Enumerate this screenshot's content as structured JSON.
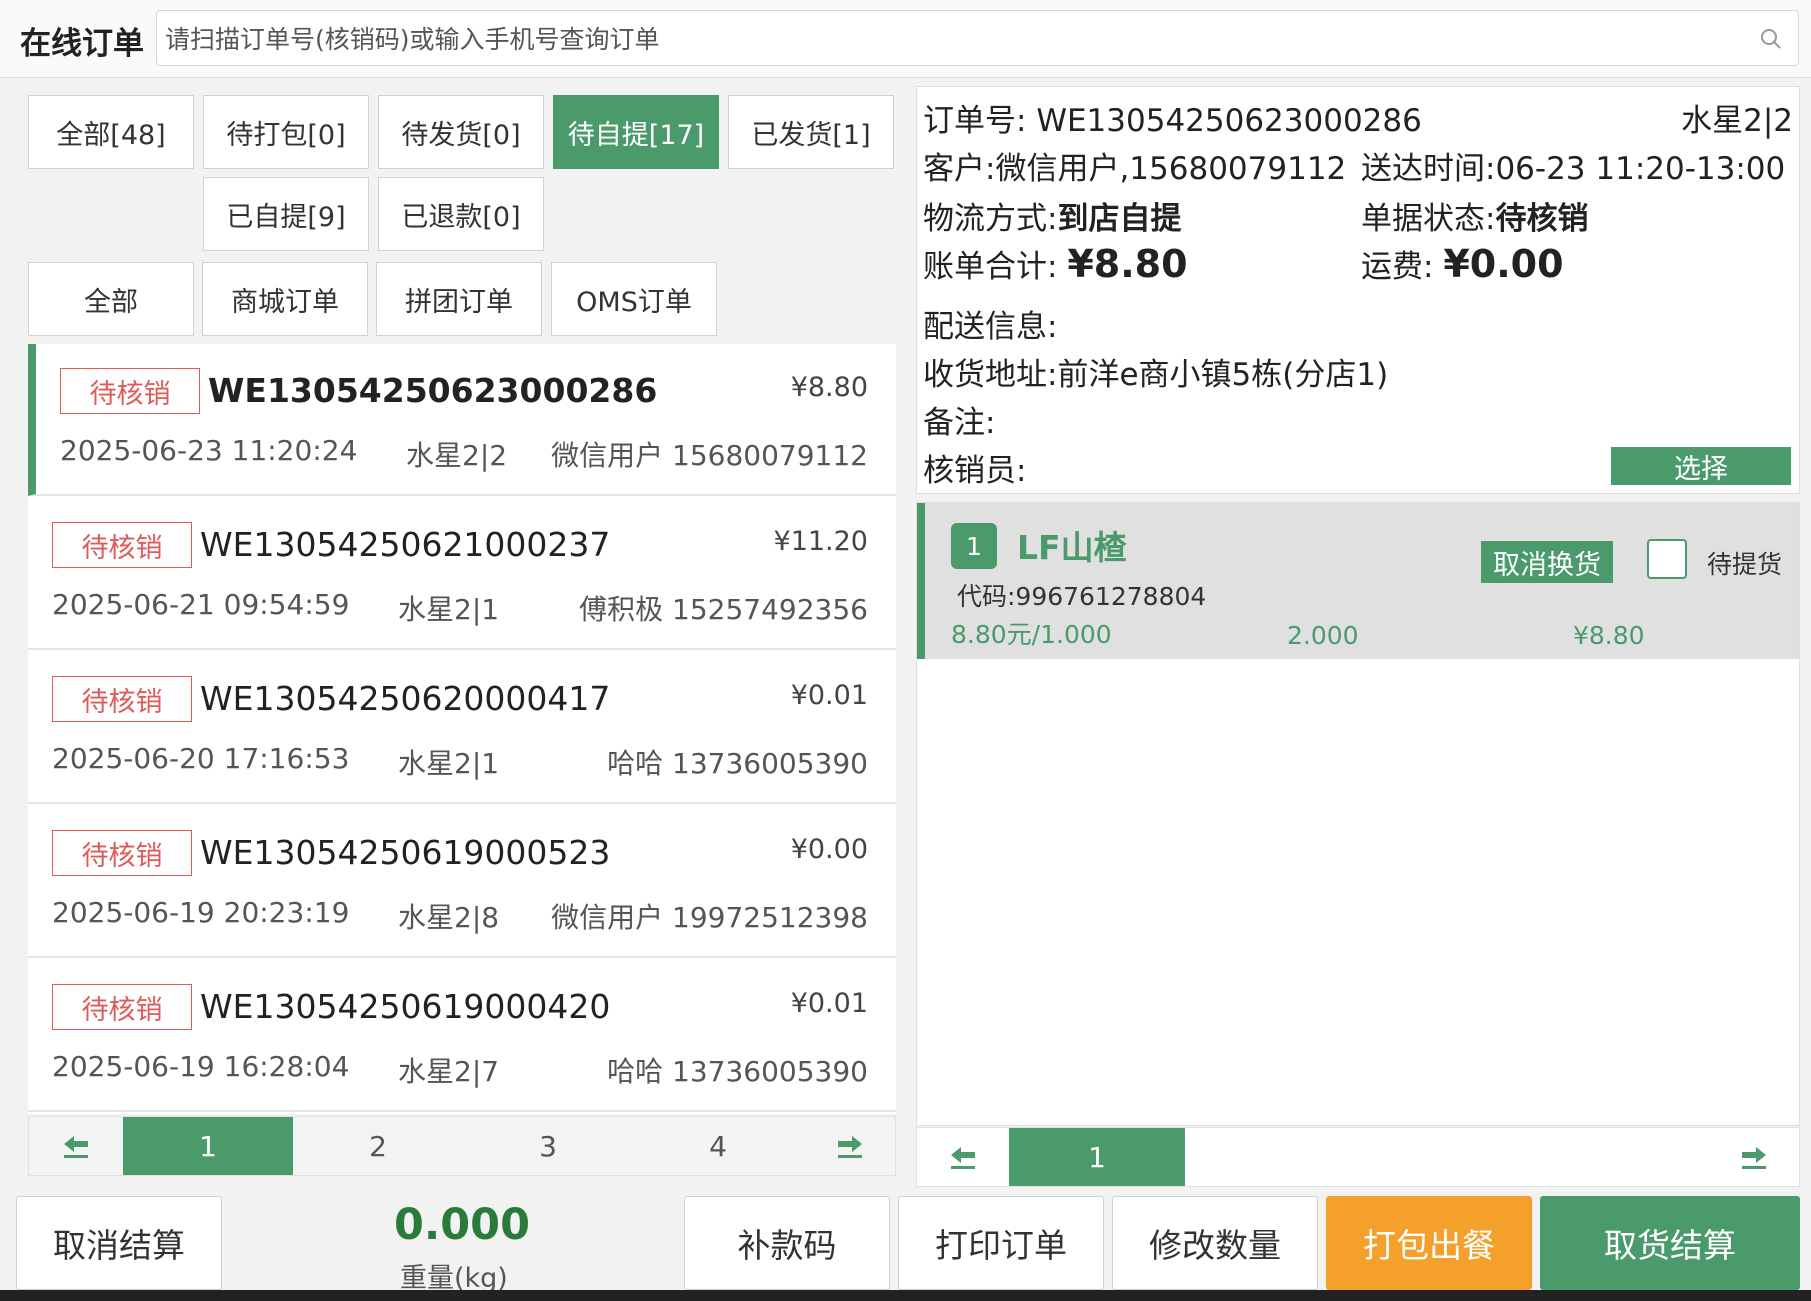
{
  "header": {
    "title": "在线订单",
    "search_placeholder": "请扫描订单号(核销码)或输入手机号查询订单"
  },
  "status_filters": [
    {
      "label": "全部[48]"
    },
    {
      "label": "待打包[0]"
    },
    {
      "label": "待发货[0]"
    },
    {
      "label": "待自提[17]",
      "active": true
    },
    {
      "label": "已发货[1]"
    },
    {
      "label": "已自提[9]"
    },
    {
      "label": "已退款[0]"
    }
  ],
  "type_filters": [
    {
      "label": "全部"
    },
    {
      "label": "商城订单"
    },
    {
      "label": "拼团订单"
    },
    {
      "label": "OMS订单"
    }
  ],
  "orders": [
    {
      "status": "待核销",
      "order_no": "WE13054250623000286",
      "amount": "¥8.80",
      "time": "2025-06-23 11:20:24",
      "table": "水星2|2",
      "customer": "微信用户 15680079112",
      "selected": true
    },
    {
      "status": "待核销",
      "order_no": "WE13054250621000237",
      "amount": "¥11.20",
      "time": "2025-06-21 09:54:59",
      "table": "水星2|1",
      "customer": "傅积极 15257492356"
    },
    {
      "status": "待核销",
      "order_no": "WE13054250620000417",
      "amount": "¥0.01",
      "time": "2025-06-20 17:16:53",
      "table": "水星2|1",
      "customer": "哈哈 13736005390"
    },
    {
      "status": "待核销",
      "order_no": "WE13054250619000523",
      "amount": "¥0.00",
      "time": "2025-06-19 20:23:19",
      "table": "水星2|8",
      "customer": "微信用户 19972512398"
    },
    {
      "status": "待核销",
      "order_no": "WE13054250619000420",
      "amount": "¥0.01",
      "time": "2025-06-19 16:28:04",
      "table": "水星2|7",
      "customer": "哈哈 13736005390"
    }
  ],
  "left_pager": {
    "pages": [
      "1",
      "2",
      "3",
      "4"
    ],
    "current": "1"
  },
  "detail": {
    "order_no_label": "订单号:",
    "order_no": "WE13054250623000286",
    "table": "水星2|2",
    "customer_label": "客户:",
    "customer": "微信用户,15680079112",
    "delivery_time_label": "送达时间:",
    "delivery_time": "06-23 11:20-13:00",
    "logistics_label": "物流方式:",
    "logistics": "到店自提",
    "status_label": "单据状态:",
    "status": "待核销",
    "bill_total_label": "账单合计:",
    "bill_total": "¥8.80",
    "freight_label": "运费:",
    "freight": "¥0.00",
    "delivery_info_label": "配送信息:",
    "address_label": "收货地址:",
    "address": "前洋e商小镇5栋(分店1)",
    "remark_label": "备注:",
    "verifier_label": "核销员:",
    "select_label": "选择"
  },
  "goods": [
    {
      "index": "1",
      "name": "LF山楂",
      "code": "代码:996761278804",
      "unit_price": "8.80元/1.000",
      "qty": "2.000",
      "total": "¥8.80",
      "exchange_label": "取消换货",
      "pending_label": "待提货"
    }
  ],
  "right_pager": {
    "pages": [
      "1"
    ],
    "current": "1"
  },
  "bottom": {
    "cancel_settle": "取消结算",
    "weight_value": "0.000",
    "weight_label": "重量(kg)",
    "pay_code": "补款码",
    "print_order": "打印订单",
    "modify_qty": "修改数量",
    "pack_out": "打包出餐",
    "pickup_settle": "取货结算"
  },
  "colors": {
    "accent_green": "#4a9a6c",
    "warning_red": "#e05a5a",
    "orange": "#f5a02a"
  }
}
